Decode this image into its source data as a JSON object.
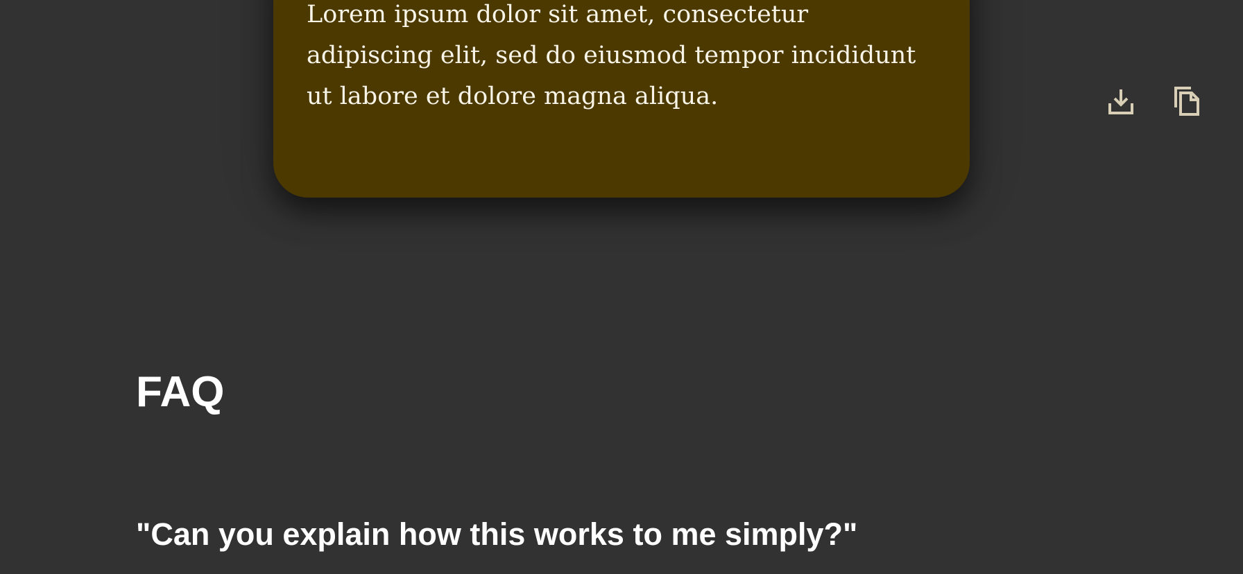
{
  "result_card": {
    "text": "Lorem ipsum dolor sit amet, consectetur\nadipiscing elit, sed do eiusmod tempor incididunt\nut labore et dolore magna aliqua.",
    "background_color": "#4b3900",
    "actions": [
      {
        "icon": "download-icon"
      },
      {
        "icon": "copy-icon"
      }
    ]
  },
  "faq": {
    "heading": "FAQ",
    "questions": [
      {
        "question": "\"Can you explain how this works to me simply?\""
      }
    ]
  },
  "colors": {
    "page_background": "#323232",
    "text": "#ffffff",
    "icon": "#d9cfb6"
  }
}
